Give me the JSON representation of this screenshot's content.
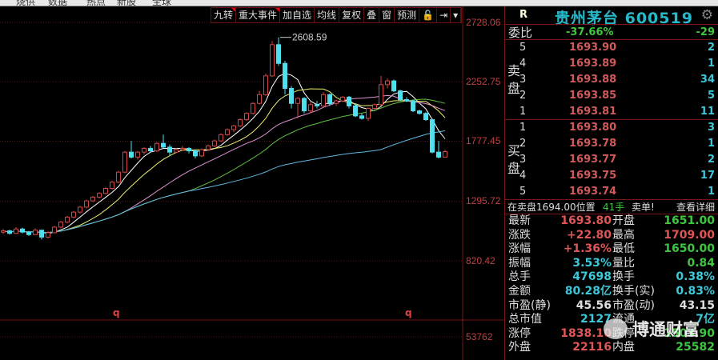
{
  "top_strip": {
    "items": [
      "烧供",
      "数据",
      "热点",
      "新股",
      "全球"
    ]
  },
  "toolbar": {
    "buttons": [
      "九转",
      "重大事件",
      "加自选",
      "均线",
      "复权",
      "叠",
      "窗",
      "预测",
      "🔓",
      "⇥",
      "▾"
    ]
  },
  "chart_data": {
    "type": "candlestick",
    "price_axis_labels": [
      "2728.06",
      "2252.75",
      "1777.45",
      "1295.72",
      "820.42"
    ],
    "ylim": [
      820.42,
      2728.06
    ],
    "volume_axis_label": "53762",
    "peak_annotation": "2608.59",
    "markers": [
      "q",
      "q"
    ],
    "colors": {
      "up": "#d04545",
      "down": "#4fe0f0",
      "ma": [
        "#ffffff",
        "#f0f070",
        "#e090d0",
        "#60c040",
        "#60b8e0"
      ]
    },
    "ma_periods": [
      5,
      10,
      20,
      30,
      60
    ],
    "candles": [
      [
        1050,
        1075,
        1035,
        1060
      ],
      [
        1060,
        1070,
        1030,
        1040
      ],
      [
        1040,
        1090,
        1035,
        1075
      ],
      [
        1075,
        1085,
        1040,
        1050
      ],
      [
        1050,
        1060,
        1020,
        1030
      ],
      [
        1030,
        1080,
        1025,
        1065
      ],
      [
        1065,
        1070,
        990,
        1010
      ],
      [
        1010,
        1060,
        1000,
        1045
      ],
      [
        1045,
        1100,
        1040,
        1090
      ],
      [
        1090,
        1140,
        1080,
        1130
      ],
      [
        1130,
        1180,
        1120,
        1170
      ],
      [
        1170,
        1220,
        1160,
        1210
      ],
      [
        1210,
        1260,
        1200,
        1250
      ],
      [
        1250,
        1310,
        1240,
        1300
      ],
      [
        1300,
        1340,
        1290,
        1330
      ],
      [
        1330,
        1370,
        1320,
        1360
      ],
      [
        1360,
        1410,
        1350,
        1400
      ],
      [
        1400,
        1460,
        1390,
        1450
      ],
      [
        1450,
        1540,
        1440,
        1530
      ],
      [
        1530,
        1700,
        1520,
        1690
      ],
      [
        1690,
        1780,
        1640,
        1650
      ],
      [
        1650,
        1700,
        1630,
        1690
      ],
      [
        1690,
        1730,
        1670,
        1720
      ],
      [
        1720,
        1740,
        1690,
        1700
      ],
      [
        1700,
        1770,
        1690,
        1760
      ],
      [
        1760,
        1830,
        1720,
        1730
      ],
      [
        1730,
        1750,
        1660,
        1690
      ],
      [
        1690,
        1720,
        1680,
        1710
      ],
      [
        1710,
        1740,
        1700,
        1720
      ],
      [
        1720,
        1730,
        1680,
        1700
      ],
      [
        1700,
        1710,
        1640,
        1660
      ],
      [
        1660,
        1720,
        1650,
        1710
      ],
      [
        1710,
        1750,
        1700,
        1740
      ],
      [
        1740,
        1790,
        1730,
        1780
      ],
      [
        1780,
        1840,
        1770,
        1830
      ],
      [
        1830,
        1880,
        1820,
        1870
      ],
      [
        1870,
        1910,
        1850,
        1900
      ],
      [
        1900,
        1960,
        1890,
        1950
      ],
      [
        1950,
        2010,
        1940,
        2000
      ],
      [
        2000,
        2090,
        1990,
        2080
      ],
      [
        2080,
        2180,
        2070,
        2150
      ],
      [
        2150,
        2320,
        2140,
        2300
      ],
      [
        2300,
        2580,
        2290,
        2550
      ],
      [
        2550,
        2608.59,
        2380,
        2400
      ],
      [
        2400,
        2420,
        2150,
        2200
      ],
      [
        2200,
        2220,
        2040,
        2080
      ],
      [
        2080,
        2130,
        1960,
        2120
      ],
      [
        2120,
        2130,
        2000,
        2020
      ],
      [
        2020,
        2090,
        2000,
        2070
      ],
      [
        2070,
        2100,
        2040,
        2060
      ],
      [
        2060,
        2170,
        2050,
        2150
      ],
      [
        2150,
        2160,
        2060,
        2080
      ],
      [
        2080,
        2110,
        2060,
        2100
      ],
      [
        2100,
        2140,
        2090,
        2130
      ],
      [
        2130,
        2140,
        2040,
        2060
      ],
      [
        2060,
        2080,
        1970,
        1980
      ],
      [
        1980,
        2000,
        1950,
        1960
      ],
      [
        1960,
        2050,
        1940,
        2040
      ],
      [
        2040,
        2080,
        2030,
        2070
      ],
      [
        2070,
        2300,
        2060,
        2230
      ],
      [
        2230,
        2280,
        2200,
        2260
      ],
      [
        2260,
        2270,
        2170,
        2180
      ],
      [
        2180,
        2190,
        2100,
        2110
      ],
      [
        2110,
        2130,
        2090,
        2100
      ],
      [
        2100,
        2110,
        2010,
        2020
      ],
      [
        2020,
        2030,
        1990,
        2000
      ],
      [
        2000,
        2010,
        1940,
        1950
      ],
      [
        1950,
        1960,
        1680,
        1690
      ],
      [
        1690,
        1780,
        1640,
        1650
      ],
      [
        1650,
        1709,
        1650,
        1694
      ]
    ]
  },
  "panel": {
    "r": "R",
    "title": "贵州茅台 600519",
    "weibi": {
      "label": "委比",
      "pct": "-37.66%",
      "diff": "-29"
    },
    "sell_label": [
      "卖",
      "盘"
    ],
    "buy_label": [
      "买",
      "盘"
    ],
    "sell": [
      {
        "n": "5",
        "p": "1693.90",
        "v": "2"
      },
      {
        "n": "4",
        "p": "1693.89",
        "v": "1"
      },
      {
        "n": "3",
        "p": "1693.88",
        "v": "34"
      },
      {
        "n": "2",
        "p": "1693.85",
        "v": "5"
      },
      {
        "n": "1",
        "p": "1693.81",
        "v": "11"
      }
    ],
    "buy": [
      {
        "n": "1",
        "p": "1693.80",
        "v": "3"
      },
      {
        "n": "2",
        "p": "1693.78",
        "v": "1"
      },
      {
        "n": "3",
        "p": "1693.77",
        "v": "2"
      },
      {
        "n": "4",
        "p": "1693.75",
        "v": "17"
      },
      {
        "n": "5",
        "p": "1693.74",
        "v": "1"
      }
    ],
    "info": {
      "pos": "在卖盘1694.00位置",
      "hands": "41手",
      "sell": "卖单!",
      "detail": "查看详细"
    },
    "stats": [
      {
        "l1": "最新",
        "v1": "1693.80",
        "c1": "red",
        "l2": "开盘",
        "v2": "1651.00",
        "c2": "grn"
      },
      {
        "l1": "涨跌",
        "v1": "+22.80",
        "c1": "red",
        "l2": "最高",
        "v2": "1709.00",
        "c2": "red"
      },
      {
        "l1": "涨幅",
        "v1": "+1.36%",
        "c1": "red",
        "l2": "最低",
        "v2": "1650.00",
        "c2": "grn"
      },
      {
        "l1": "振幅",
        "v1": "3.53%",
        "c1": "cyn",
        "l2": "量比",
        "v2": "0.84",
        "c2": "grn"
      },
      {
        "l1": "总手",
        "v1": "47698",
        "c1": "cyn",
        "l2": "换手",
        "v2": "0.38%",
        "c2": "cyn"
      },
      {
        "l1": "金额",
        "v1": "80.28亿",
        "c1": "cyn",
        "l2": "换手(实)",
        "v2": "0.83%",
        "c2": "cyn"
      },
      {
        "l1": "市盈(静)",
        "v1": "45.56",
        "c1": "wht",
        "l2": "市盈(动)",
        "v2": "43.15",
        "c2": "wht"
      },
      {
        "l1": "总市值",
        "v1": "2127",
        "c1": "cyn",
        "l2": "流通",
        "v2": "7亿",
        "c2": "cyn"
      },
      {
        "l1": "涨停",
        "v1": "1838.10",
        "c1": "red",
        "l2": "跌停",
        "v2": "1503.90",
        "c2": "grn"
      },
      {
        "l1": "外盘",
        "v1": "22116",
        "c1": "red",
        "l2": "内盘",
        "v2": "25582",
        "c2": "grn"
      }
    ]
  },
  "watermark": "博通财富"
}
